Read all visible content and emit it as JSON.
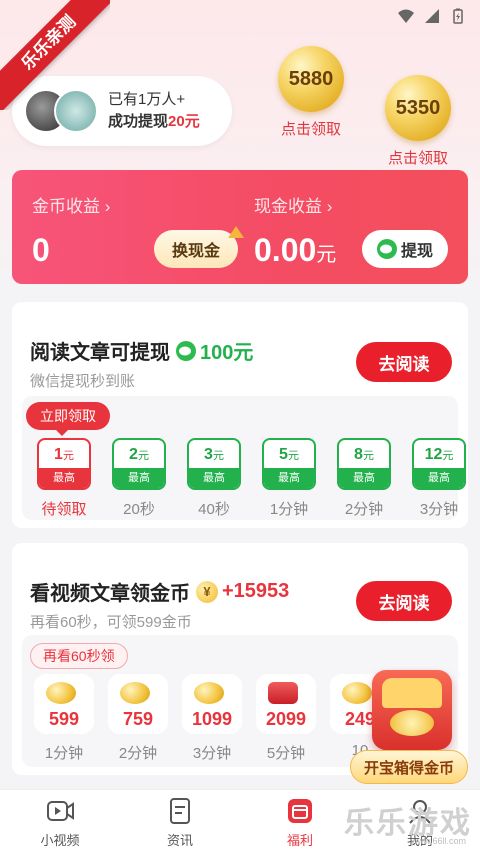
{
  "ribbon": "乐乐亲测",
  "users": {
    "line1": "已有1万人+",
    "line2_prefix": "成功提现",
    "line2_amount": "20元"
  },
  "coins": [
    {
      "value": "5880",
      "label": "点击领取"
    },
    {
      "value": "5350",
      "label": "点击领取"
    }
  ],
  "earnings": {
    "gold_label": "金币收益",
    "gold_value": "0",
    "exchange_label": "换现金",
    "cash_label": "现金收益",
    "cash_value": "0.00",
    "cash_unit": "元",
    "withdraw_label": "提现"
  },
  "read_task": {
    "title": "阅读文章可提现",
    "amount": "100元",
    "subtitle": "微信提现秒到账",
    "button": "去阅读",
    "claim_tag": "立即领取",
    "items": [
      {
        "amount": "1",
        "unit": "元",
        "foot": "最高",
        "time": "待领取",
        "active": true
      },
      {
        "amount": "2",
        "unit": "元",
        "foot": "最高",
        "time": "20秒"
      },
      {
        "amount": "3",
        "unit": "元",
        "foot": "最高",
        "time": "40秒"
      },
      {
        "amount": "5",
        "unit": "元",
        "foot": "最高",
        "time": "1分钟"
      },
      {
        "amount": "8",
        "unit": "元",
        "foot": "最高",
        "time": "2分钟"
      },
      {
        "amount": "12",
        "unit": "元",
        "foot": "最高",
        "time": "3分钟"
      }
    ]
  },
  "video_task": {
    "title": "看视频文章领金币",
    "amount": "+15953",
    "coin_symbol": "¥",
    "subtitle": "再看60秒，可领599金币",
    "button": "去阅读",
    "tag": "再看60秒领",
    "items": [
      {
        "value": "599",
        "time": "1分钟"
      },
      {
        "value": "759",
        "time": "2分钟"
      },
      {
        "value": "1099",
        "time": "3分钟"
      },
      {
        "value": "2099",
        "time": "5分钟",
        "gift": true
      },
      {
        "value": "249",
        "time": "10"
      }
    ]
  },
  "treasure_button": "开宝箱得金币",
  "nav": [
    {
      "label": "小视频"
    },
    {
      "label": "资讯"
    },
    {
      "label": "福利",
      "active": true
    },
    {
      "label": "我的"
    }
  ],
  "watermark": "乐乐游戏",
  "watermark_url": "www.66ll.com",
  "colors": {
    "accent": "#e8343c",
    "green": "#22b14c",
    "card_gradient": "#f7547a"
  }
}
